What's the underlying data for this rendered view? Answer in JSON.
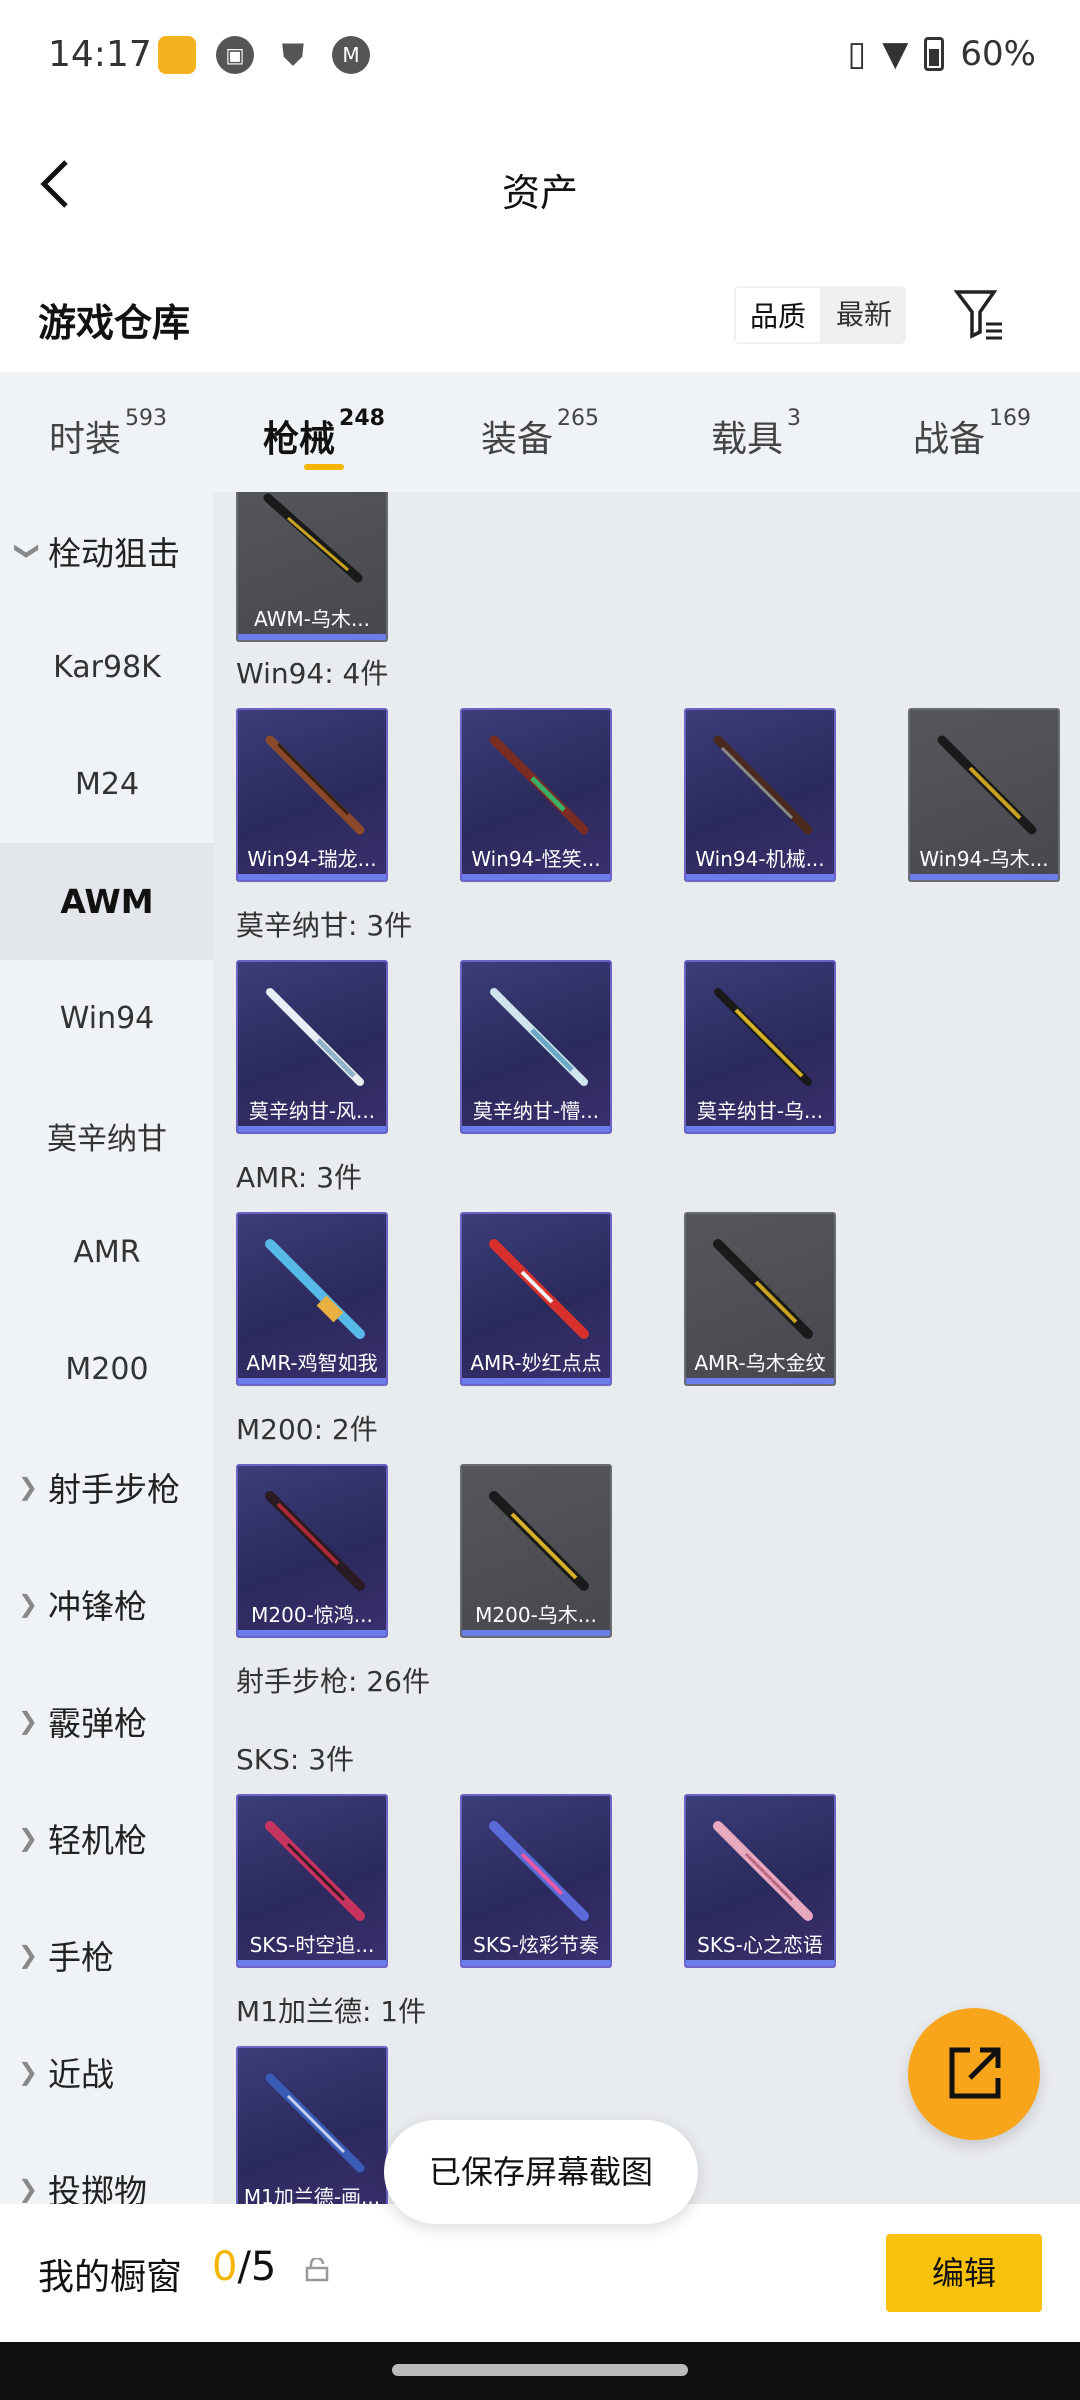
{
  "status_bar": {
    "time": "14:17",
    "battery": "60%"
  },
  "header": {
    "title": "资产"
  },
  "warehouse": {
    "title": "游戏仓库",
    "sort_quality": "品质",
    "sort_latest": "最新"
  },
  "tabs": [
    {
      "label": "时装",
      "count": "593"
    },
    {
      "label": "枪械",
      "count": "248"
    },
    {
      "label": "装备",
      "count": "265"
    },
    {
      "label": "载具",
      "count": "3"
    },
    {
      "label": "战备",
      "count": "169"
    }
  ],
  "sidebar": {
    "items": [
      {
        "label": "栓动狙击"
      },
      {
        "label": "Kar98K"
      },
      {
        "label": "M24"
      },
      {
        "label": "AWM"
      },
      {
        "label": "Win94"
      },
      {
        "label": "莫辛纳甘"
      },
      {
        "label": "AMR"
      },
      {
        "label": "M200"
      },
      {
        "label": "射手步枪"
      },
      {
        "label": "冲锋枪"
      },
      {
        "label": "霰弹枪"
      },
      {
        "label": "轻机枪"
      },
      {
        "label": "手枪"
      },
      {
        "label": "近战"
      },
      {
        "label": "投掷物"
      }
    ]
  },
  "sections": {
    "awm": {
      "items": [
        "AWM-乌木..."
      ]
    },
    "win94": {
      "label": "Win94: 4件",
      "items": [
        "Win94-瑞龙...",
        "Win94-怪笑...",
        "Win94-机械...",
        "Win94-乌木..."
      ]
    },
    "mosin": {
      "label": "莫辛纳甘: 3件",
      "items": [
        "莫辛纳甘-风...",
        "莫辛纳甘-懵...",
        "莫辛纳甘-乌..."
      ]
    },
    "amr": {
      "label": "AMR: 3件",
      "items": [
        "AMR-鸡智如我",
        "AMR-妙红点点",
        "AMR-乌木金纹"
      ]
    },
    "m200": {
      "label": "M200: 2件",
      "items": [
        "M200-惊鸿...",
        "M200-乌木..."
      ]
    },
    "marksman": {
      "label": "射手步枪: 26件"
    },
    "sks": {
      "label": "SKS: 3件",
      "items": [
        "SKS-时空追...",
        "SKS-炫彩节奏",
        "SKS-心之恋语"
      ]
    },
    "m1": {
      "label": "M1加兰德: 1件",
      "items": [
        "M1加兰德-画..."
      ]
    }
  },
  "toast": "已保存屏幕截图",
  "bottom": {
    "label": "我的橱窗",
    "count_current": "0",
    "count_total": "/5",
    "edit": "编辑"
  },
  "colors": {
    "accent": "#f5b400",
    "fab": "#f8a51c",
    "edit_button": "#f8c20c",
    "rarity_bar": "#6a7de8"
  }
}
